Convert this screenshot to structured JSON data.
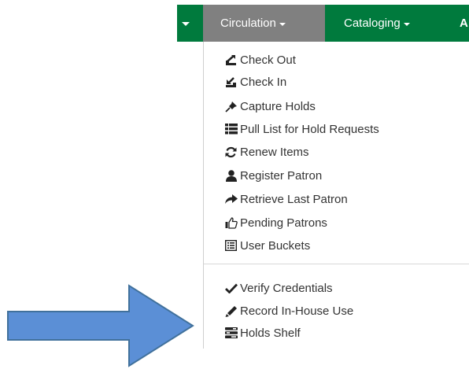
{
  "navbar": {
    "background": "#007a3d",
    "active_background": "#808080",
    "items": [
      {
        "label": "Circulation"
      },
      {
        "label": "Cataloging"
      },
      {
        "label": "A"
      }
    ]
  },
  "dropdown": {
    "items": [
      {
        "label": "Check Out",
        "icon": "check-out-icon"
      },
      {
        "label": "Check In",
        "icon": "check-in-icon"
      },
      {
        "label": "Capture Holds",
        "icon": "pushpin-icon"
      },
      {
        "label": "Pull List for Hold Requests",
        "icon": "list-icon"
      },
      {
        "label": "Renew Items",
        "icon": "refresh-icon"
      },
      {
        "label": "Register Patron",
        "icon": "user-icon"
      },
      {
        "label": "Retrieve Last Patron",
        "icon": "share-arrow-icon"
      },
      {
        "label": "Pending Patrons",
        "icon": "thumbs-up-icon"
      },
      {
        "label": "User Buckets",
        "icon": "list-alt-icon"
      },
      {
        "label": "Verify Credentials",
        "icon": "checkmark-icon"
      },
      {
        "label": "Record In-House Use",
        "icon": "pencil-icon"
      },
      {
        "label": "Holds Shelf",
        "icon": "tasks-icon"
      }
    ]
  },
  "annotation": {
    "arrow_color": "#5b8fd6",
    "arrow_border": "#41719c",
    "arrow_icon": "right-arrow-icon"
  }
}
